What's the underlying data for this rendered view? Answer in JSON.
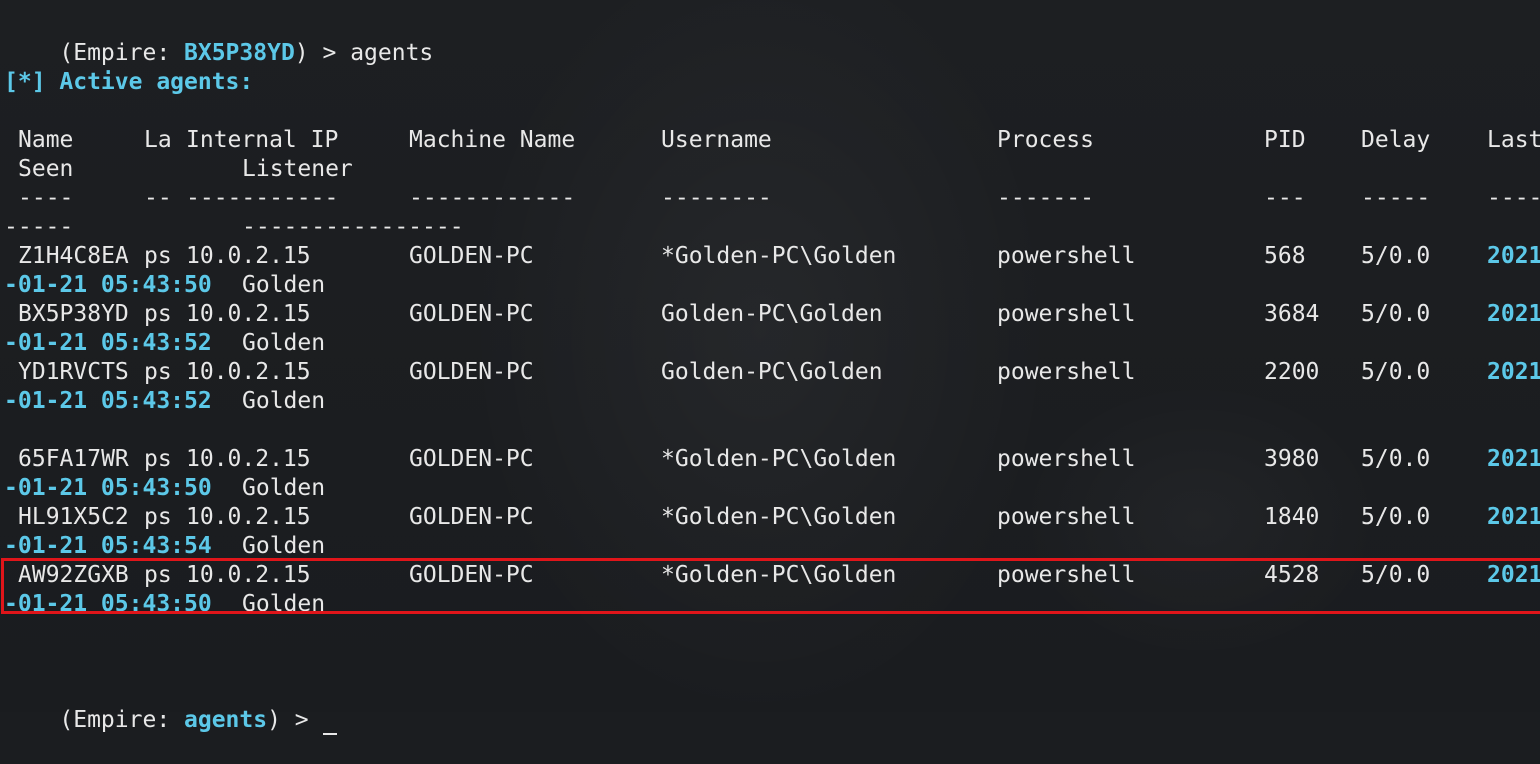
{
  "prompt1": {
    "open": "(Empire: ",
    "context": "BX5P38YD",
    "close": ") > ",
    "command": "agents"
  },
  "section_header": "[*] Active agents:",
  "table": {
    "columns": [
      "Name",
      "La",
      "Internal IP",
      "Machine Name",
      "Username",
      "Process",
      "PID",
      "Delay",
      "Last"
    ],
    "columns_wrap": [
      "Seen",
      "Listener"
    ],
    "separators": [
      "----",
      "--",
      "-----------",
      "------------",
      "--------",
      "-------",
      "---",
      "-----",
      "----"
    ],
    "separators_wrap": [
      "-----",
      "----------------"
    ],
    "rows": [
      {
        "name": "Z1H4C8EA",
        "la": "ps",
        "ip": "10.0.2.15",
        "machine": "GOLDEN-PC",
        "username": "*Golden-PC\\Golden",
        "process": "powershell",
        "pid": "568",
        "delay": "5/0.0",
        "last_a": "2021",
        "last_b": "-01-21 05:43:50",
        "listener": "Golden"
      },
      {
        "name": "BX5P38YD",
        "la": "ps",
        "ip": "10.0.2.15",
        "machine": "GOLDEN-PC",
        "username": "Golden-PC\\Golden",
        "process": "powershell",
        "pid": "3684",
        "delay": "5/0.0",
        "last_a": "2021",
        "last_b": "-01-21 05:43:52",
        "listener": "Golden"
      },
      {
        "name": "YD1RVCTS",
        "la": "ps",
        "ip": "10.0.2.15",
        "machine": "GOLDEN-PC",
        "username": "Golden-PC\\Golden",
        "process": "powershell",
        "pid": "2200",
        "delay": "5/0.0",
        "last_a": "2021",
        "last_b": "-01-21 05:43:52",
        "listener": "Golden"
      },
      {
        "name": "65FA17WR",
        "la": "ps",
        "ip": "10.0.2.15",
        "machine": "GOLDEN-PC",
        "username": "*Golden-PC\\Golden",
        "process": "powershell",
        "pid": "3980",
        "delay": "5/0.0",
        "last_a": "2021",
        "last_b": "-01-21 05:43:50",
        "listener": "Golden"
      },
      {
        "name": "HL91X5C2",
        "la": "ps",
        "ip": "10.0.2.15",
        "machine": "GOLDEN-PC",
        "username": "*Golden-PC\\Golden",
        "process": "powershell",
        "pid": "1840",
        "delay": "5/0.0",
        "last_a": "2021",
        "last_b": "-01-21 05:43:54",
        "listener": "Golden"
      },
      {
        "name": "AW92ZGXB",
        "la": "ps",
        "ip": "10.0.2.15",
        "machine": "GOLDEN-PC",
        "username": "*Golden-PC\\Golden",
        "process": "powershell",
        "pid": "4528",
        "delay": "5/0.0",
        "last_a": "2021",
        "last_b": "-01-21 05:43:50",
        "listener": "Golden"
      }
    ]
  },
  "prompt2": {
    "open": "(Empire: ",
    "context": "agents",
    "close": ") > "
  },
  "colors": {
    "background": "#1b1d20",
    "text": "#e8e8e8",
    "accent": "#5cc8e8",
    "highlight_box": "#e0151a"
  }
}
